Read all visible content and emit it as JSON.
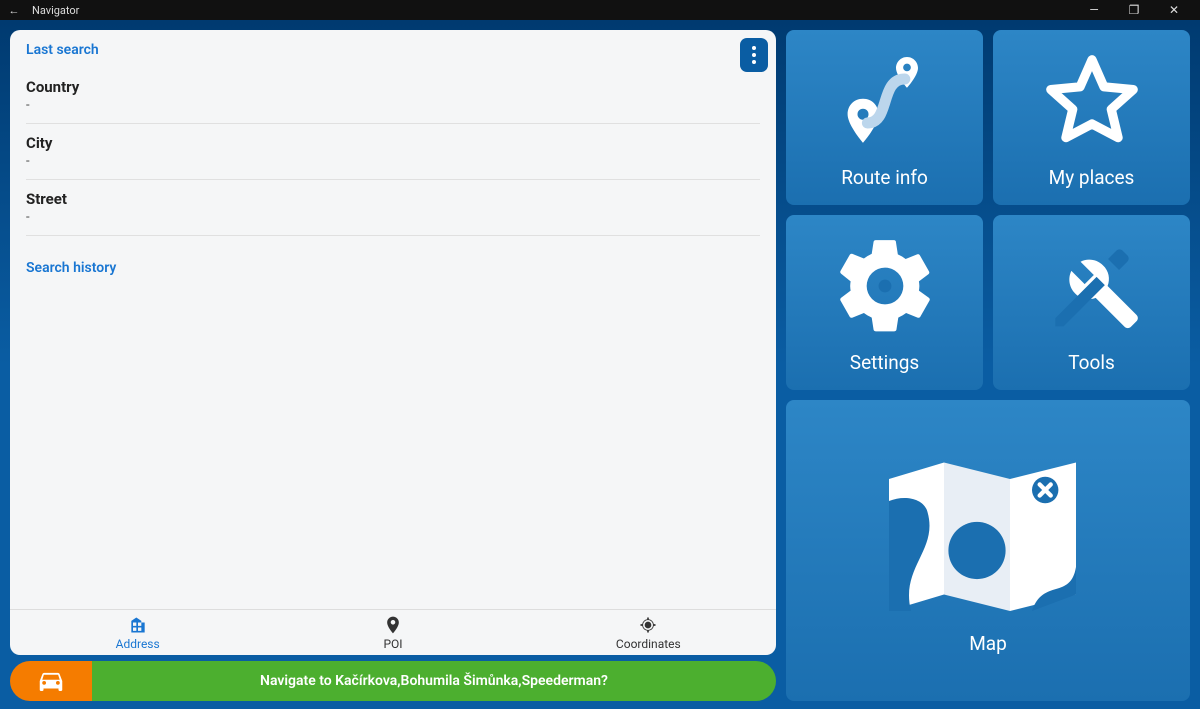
{
  "window": {
    "title": "Navigator"
  },
  "panel": {
    "last_search_label": "Last search",
    "fields": {
      "country": {
        "label": "Country",
        "value": "-"
      },
      "city": {
        "label": "City",
        "value": "-"
      },
      "street": {
        "label": "Street",
        "value": "-"
      }
    },
    "search_history_label": "Search history"
  },
  "tabs": {
    "address": "Address",
    "poi": "POI",
    "coordinates": "Coordinates"
  },
  "navigate_prompt": "Navigate to Kačírkova,Bohumila Šimůnka,Speederman?",
  "tiles": {
    "route_info": "Route info",
    "my_places": "My places",
    "settings": "Settings",
    "tools": "Tools",
    "map": "Map"
  }
}
